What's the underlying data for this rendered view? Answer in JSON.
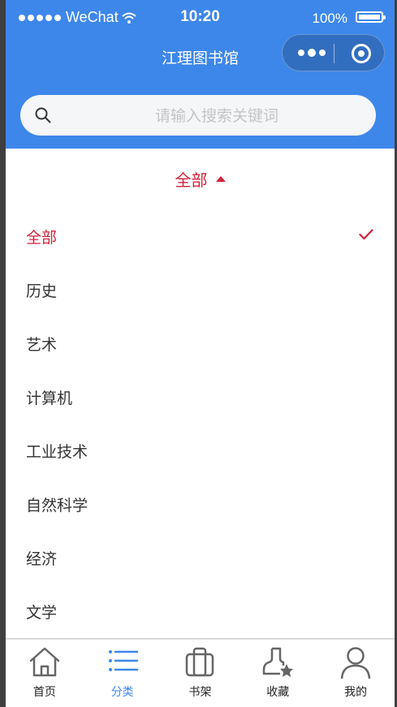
{
  "status_bar": {
    "carrier": "WeChat",
    "time": "10:20",
    "battery": "100%"
  },
  "header": {
    "title": "江理图书馆"
  },
  "search": {
    "placeholder": "请输入搜索关键词"
  },
  "filter": {
    "label": "全部"
  },
  "categories": [
    {
      "label": "全部",
      "selected": true
    },
    {
      "label": "历史",
      "selected": false
    },
    {
      "label": "艺术",
      "selected": false
    },
    {
      "label": "计算机",
      "selected": false
    },
    {
      "label": "工业技术",
      "selected": false
    },
    {
      "label": "自然科学",
      "selected": false
    },
    {
      "label": "经济",
      "selected": false
    },
    {
      "label": "文学",
      "selected": false
    }
  ],
  "tabbar": [
    {
      "label": "首页",
      "icon": "home-icon",
      "active": false
    },
    {
      "label": "分类",
      "icon": "list-icon",
      "active": true
    },
    {
      "label": "书架",
      "icon": "bookshelf-icon",
      "active": false
    },
    {
      "label": "收藏",
      "icon": "favorite-user-icon",
      "active": false
    },
    {
      "label": "我的",
      "icon": "profile-icon",
      "active": false
    }
  ],
  "colors": {
    "primary": "#3d87ea",
    "accent": "#d3223b",
    "inactive_icon": "#666666"
  }
}
